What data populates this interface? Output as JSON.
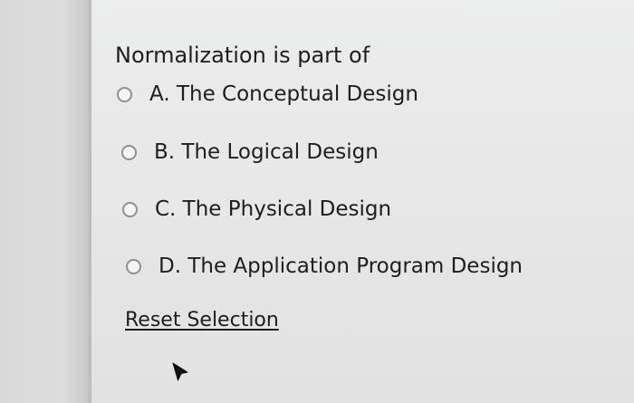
{
  "question": {
    "text": "Normalization is part of",
    "options": [
      {
        "label": "A. The Conceptual Design",
        "selected": false
      },
      {
        "label": "B. The Logical Design",
        "selected": false
      },
      {
        "label": "C. The Physical Design",
        "selected": false
      },
      {
        "label": "D. The Application Program Design",
        "selected": false
      }
    ]
  },
  "reset_label": "Reset Selection",
  "icons": {
    "radio": "radio-button-icon",
    "cursor": "mouse-pointer-icon"
  },
  "colors": {
    "text": "#1e1e1e",
    "radio_border": "#8f9290",
    "background": "#e6e7e6"
  }
}
